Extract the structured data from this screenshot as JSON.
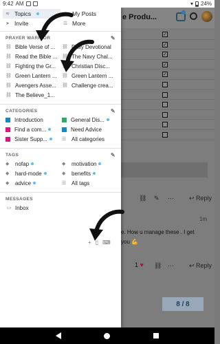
{
  "status_bar": {
    "time": "9:42",
    "am_pm": "AM",
    "battery": "24%"
  },
  "background": {
    "title": "e Produ...",
    "checks": [
      "☑",
      "☑",
      "☑",
      "☑",
      "☑",
      "☐",
      "☐",
      "☐",
      "☐",
      "☐",
      "☐"
    ],
    "reply1": "Reply",
    "time": "1m",
    "text1": "e. How u manage these . I get",
    "text2": "you",
    "like_count": "1",
    "reply2": "Reply",
    "pager": "8 / 8"
  },
  "drawer": {
    "top_links": [
      {
        "label": "Topics",
        "icon": "layers-icon",
        "dot": true,
        "active": true
      },
      {
        "label": "My Posts",
        "icon": "user-icon",
        "dot": false,
        "active": false
      },
      {
        "label": "Invite",
        "icon": "paper-plane-icon",
        "dot": false,
        "active": false
      },
      {
        "label": "More",
        "icon": "menu-icon",
        "dot": false,
        "active": false
      }
    ],
    "prayer": {
      "heading": "PRAYER WARRIOR",
      "items": [
        "Bible Verse of ...",
        "Daily Devotional",
        "Read the Bible ...",
        "The Navy Chal...",
        "Fighting the Gr...",
        "Christian Disc...",
        "Green Lantern ...",
        "Green Lantern ...",
        "Avengers Asse...",
        "Challenge crea...",
        "The Believe_1..."
      ]
    },
    "categories": {
      "heading": "CATEGORIES",
      "items": [
        {
          "label": "Introduction",
          "color": "#0d8ac7",
          "dot": false
        },
        {
          "label": "General Dis...",
          "color": "#27ae60",
          "dot": true
        },
        {
          "label": "Find a com...",
          "color": "#e2137c",
          "dot": true
        },
        {
          "label": "Need Advice",
          "color": "#0d8ac7",
          "dot": false
        },
        {
          "label": "Sister Supp...",
          "color": "#e2137c",
          "dot": true
        },
        {
          "label": "All categories",
          "color": "",
          "dot": false
        }
      ]
    },
    "tags": {
      "heading": "TAGS",
      "items": [
        {
          "label": "nofap",
          "dot": true
        },
        {
          "label": "motivation",
          "dot": true
        },
        {
          "label": "hard-mode",
          "dot": true
        },
        {
          "label": "benefits",
          "dot": true
        },
        {
          "label": "advice",
          "dot": true
        },
        {
          "label": "All tags",
          "dot": false
        }
      ]
    },
    "messages": {
      "heading": "MESSAGES",
      "inbox": "Inbox"
    }
  }
}
